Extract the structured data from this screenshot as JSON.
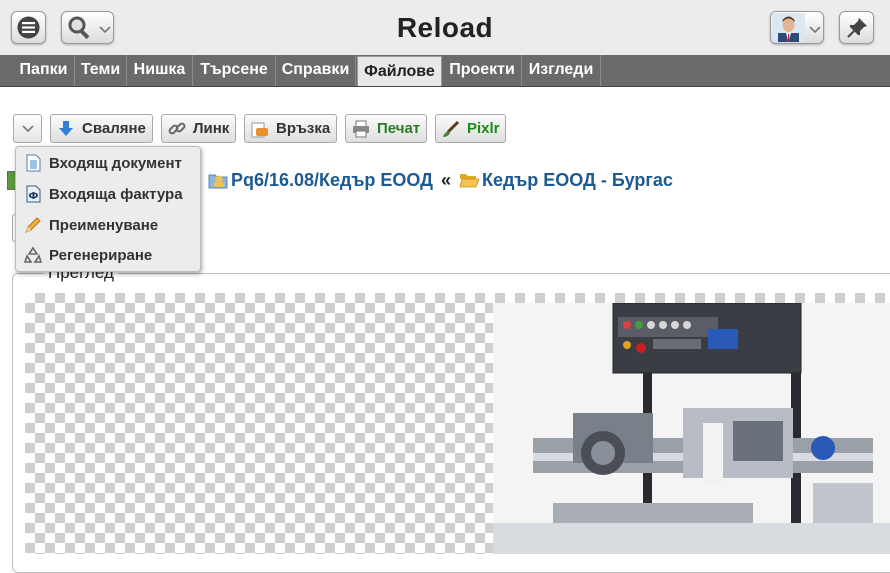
{
  "app": {
    "title": "Reload"
  },
  "topbar": {
    "menu_icon": "hamburger-icon",
    "search_icon": "search-icon",
    "pin_icon": "pin-icon",
    "avatar": "user-avatar"
  },
  "nav": {
    "items": [
      {
        "label": "Папки"
      },
      {
        "label": "Теми"
      },
      {
        "label": "Нишка"
      },
      {
        "label": "Търсене"
      },
      {
        "label": "Справки"
      },
      {
        "label": "Файлове",
        "active": true
      },
      {
        "label": "Проекти"
      },
      {
        "label": "Изгледи"
      }
    ]
  },
  "toolbar": {
    "download": "Сваляне",
    "link": "Линк",
    "relation": "Връзка",
    "print": "Печат",
    "pixlr": "Pixlr"
  },
  "dropdown": {
    "items": [
      {
        "label": "Входящ документ",
        "icon": "incoming-document-icon"
      },
      {
        "label": "Входяща фактура",
        "icon": "incoming-invoice-icon"
      },
      {
        "label": "Преименуване",
        "icon": "pencil-icon"
      },
      {
        "label": "Регенериране",
        "icon": "recycle-icon"
      }
    ]
  },
  "breadcrumb": {
    "visible_separator": ":",
    "item1": "Рq6/16.08/Кедър ЕООД",
    "separator": "«",
    "item2": "Кедър ЕООД - Бургас"
  },
  "preview": {
    "legend": "Преглед"
  },
  "colors": {
    "nav_bg": "#6a6a6a",
    "link": "#1c5a91",
    "pixlr_green": "#1a8a1a",
    "print_green": "#2a7a2a"
  }
}
